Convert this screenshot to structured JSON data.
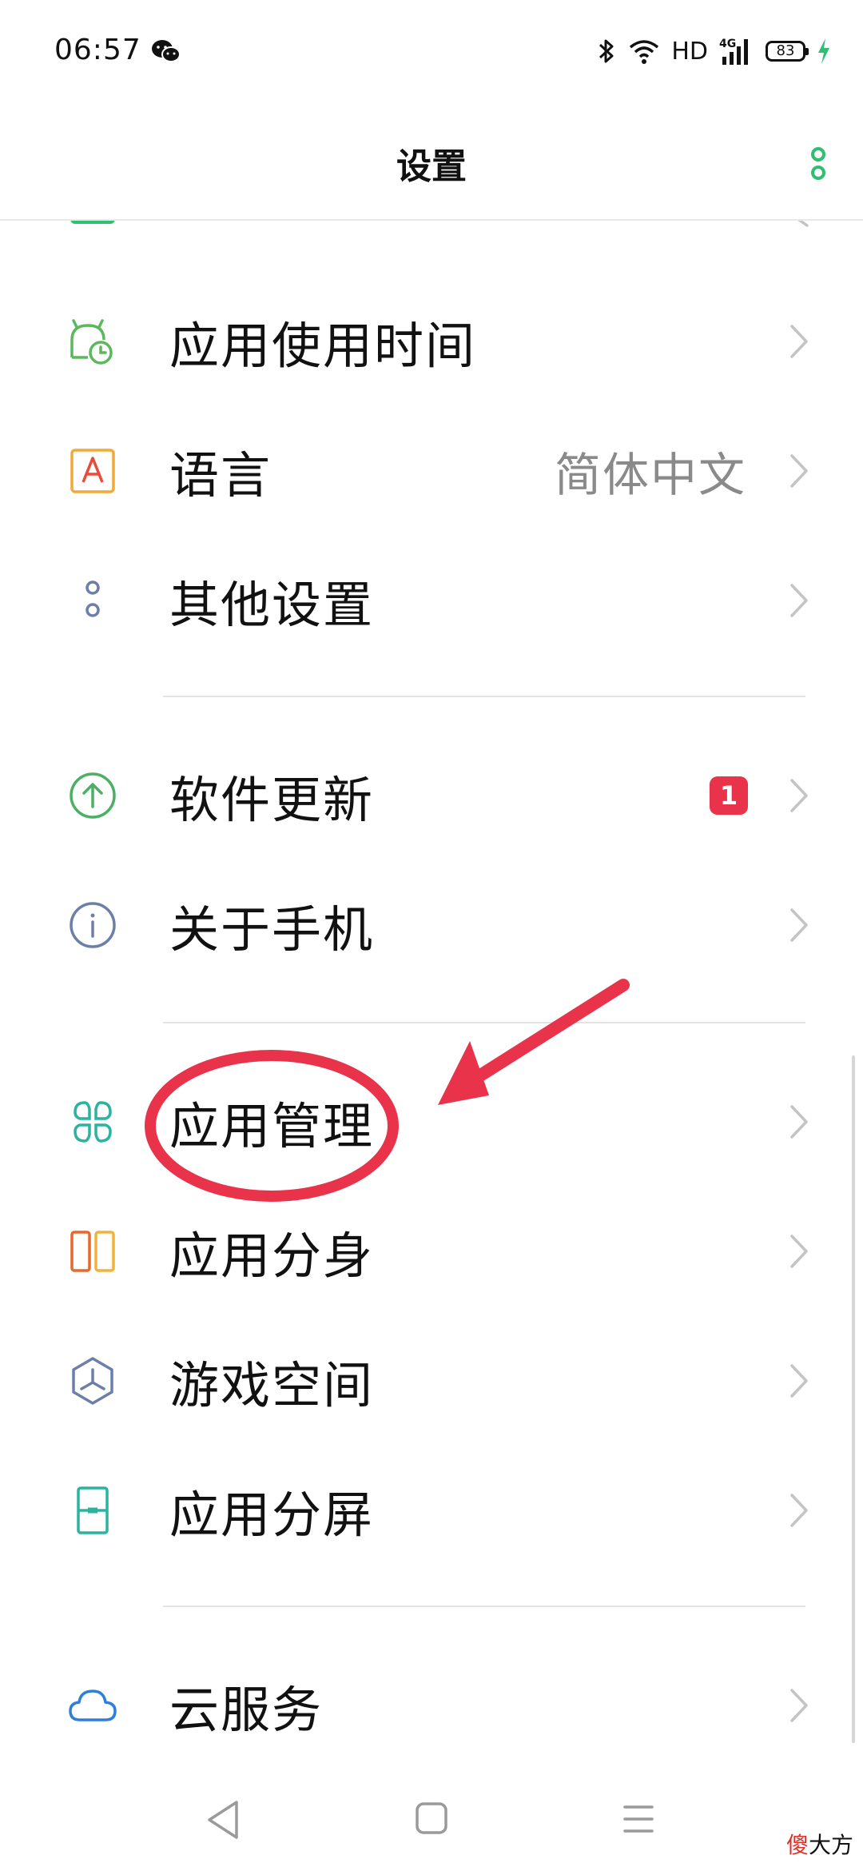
{
  "status_bar": {
    "time": "06:57",
    "network_hd": "HD",
    "network_type": "4G",
    "battery_level": "83"
  },
  "header": {
    "title": "设置"
  },
  "items": [
    {
      "label": "应用使用时间",
      "icon": "app-usage-timer-icon"
    },
    {
      "label": "语言",
      "value": "简体中文",
      "icon": "language-icon"
    },
    {
      "label": "其他设置",
      "icon": "other-settings-icon"
    },
    {
      "label": "软件更新",
      "badge": "1",
      "icon": "software-update-icon"
    },
    {
      "label": "关于手机",
      "icon": "about-phone-icon"
    },
    {
      "label": "应用管理",
      "icon": "app-management-icon"
    },
    {
      "label": "应用分身",
      "icon": "app-clone-icon"
    },
    {
      "label": "游戏空间",
      "icon": "game-space-icon"
    },
    {
      "label": "应用分屏",
      "icon": "split-screen-icon"
    },
    {
      "label": "云服务",
      "icon": "cloud-service-icon"
    }
  ],
  "watermark": {
    "red_text": "傻",
    "text": "大方"
  },
  "colors": {
    "badge": "#e8334a",
    "annotation": "#e8334a",
    "accent_green": "#2fbf71"
  }
}
